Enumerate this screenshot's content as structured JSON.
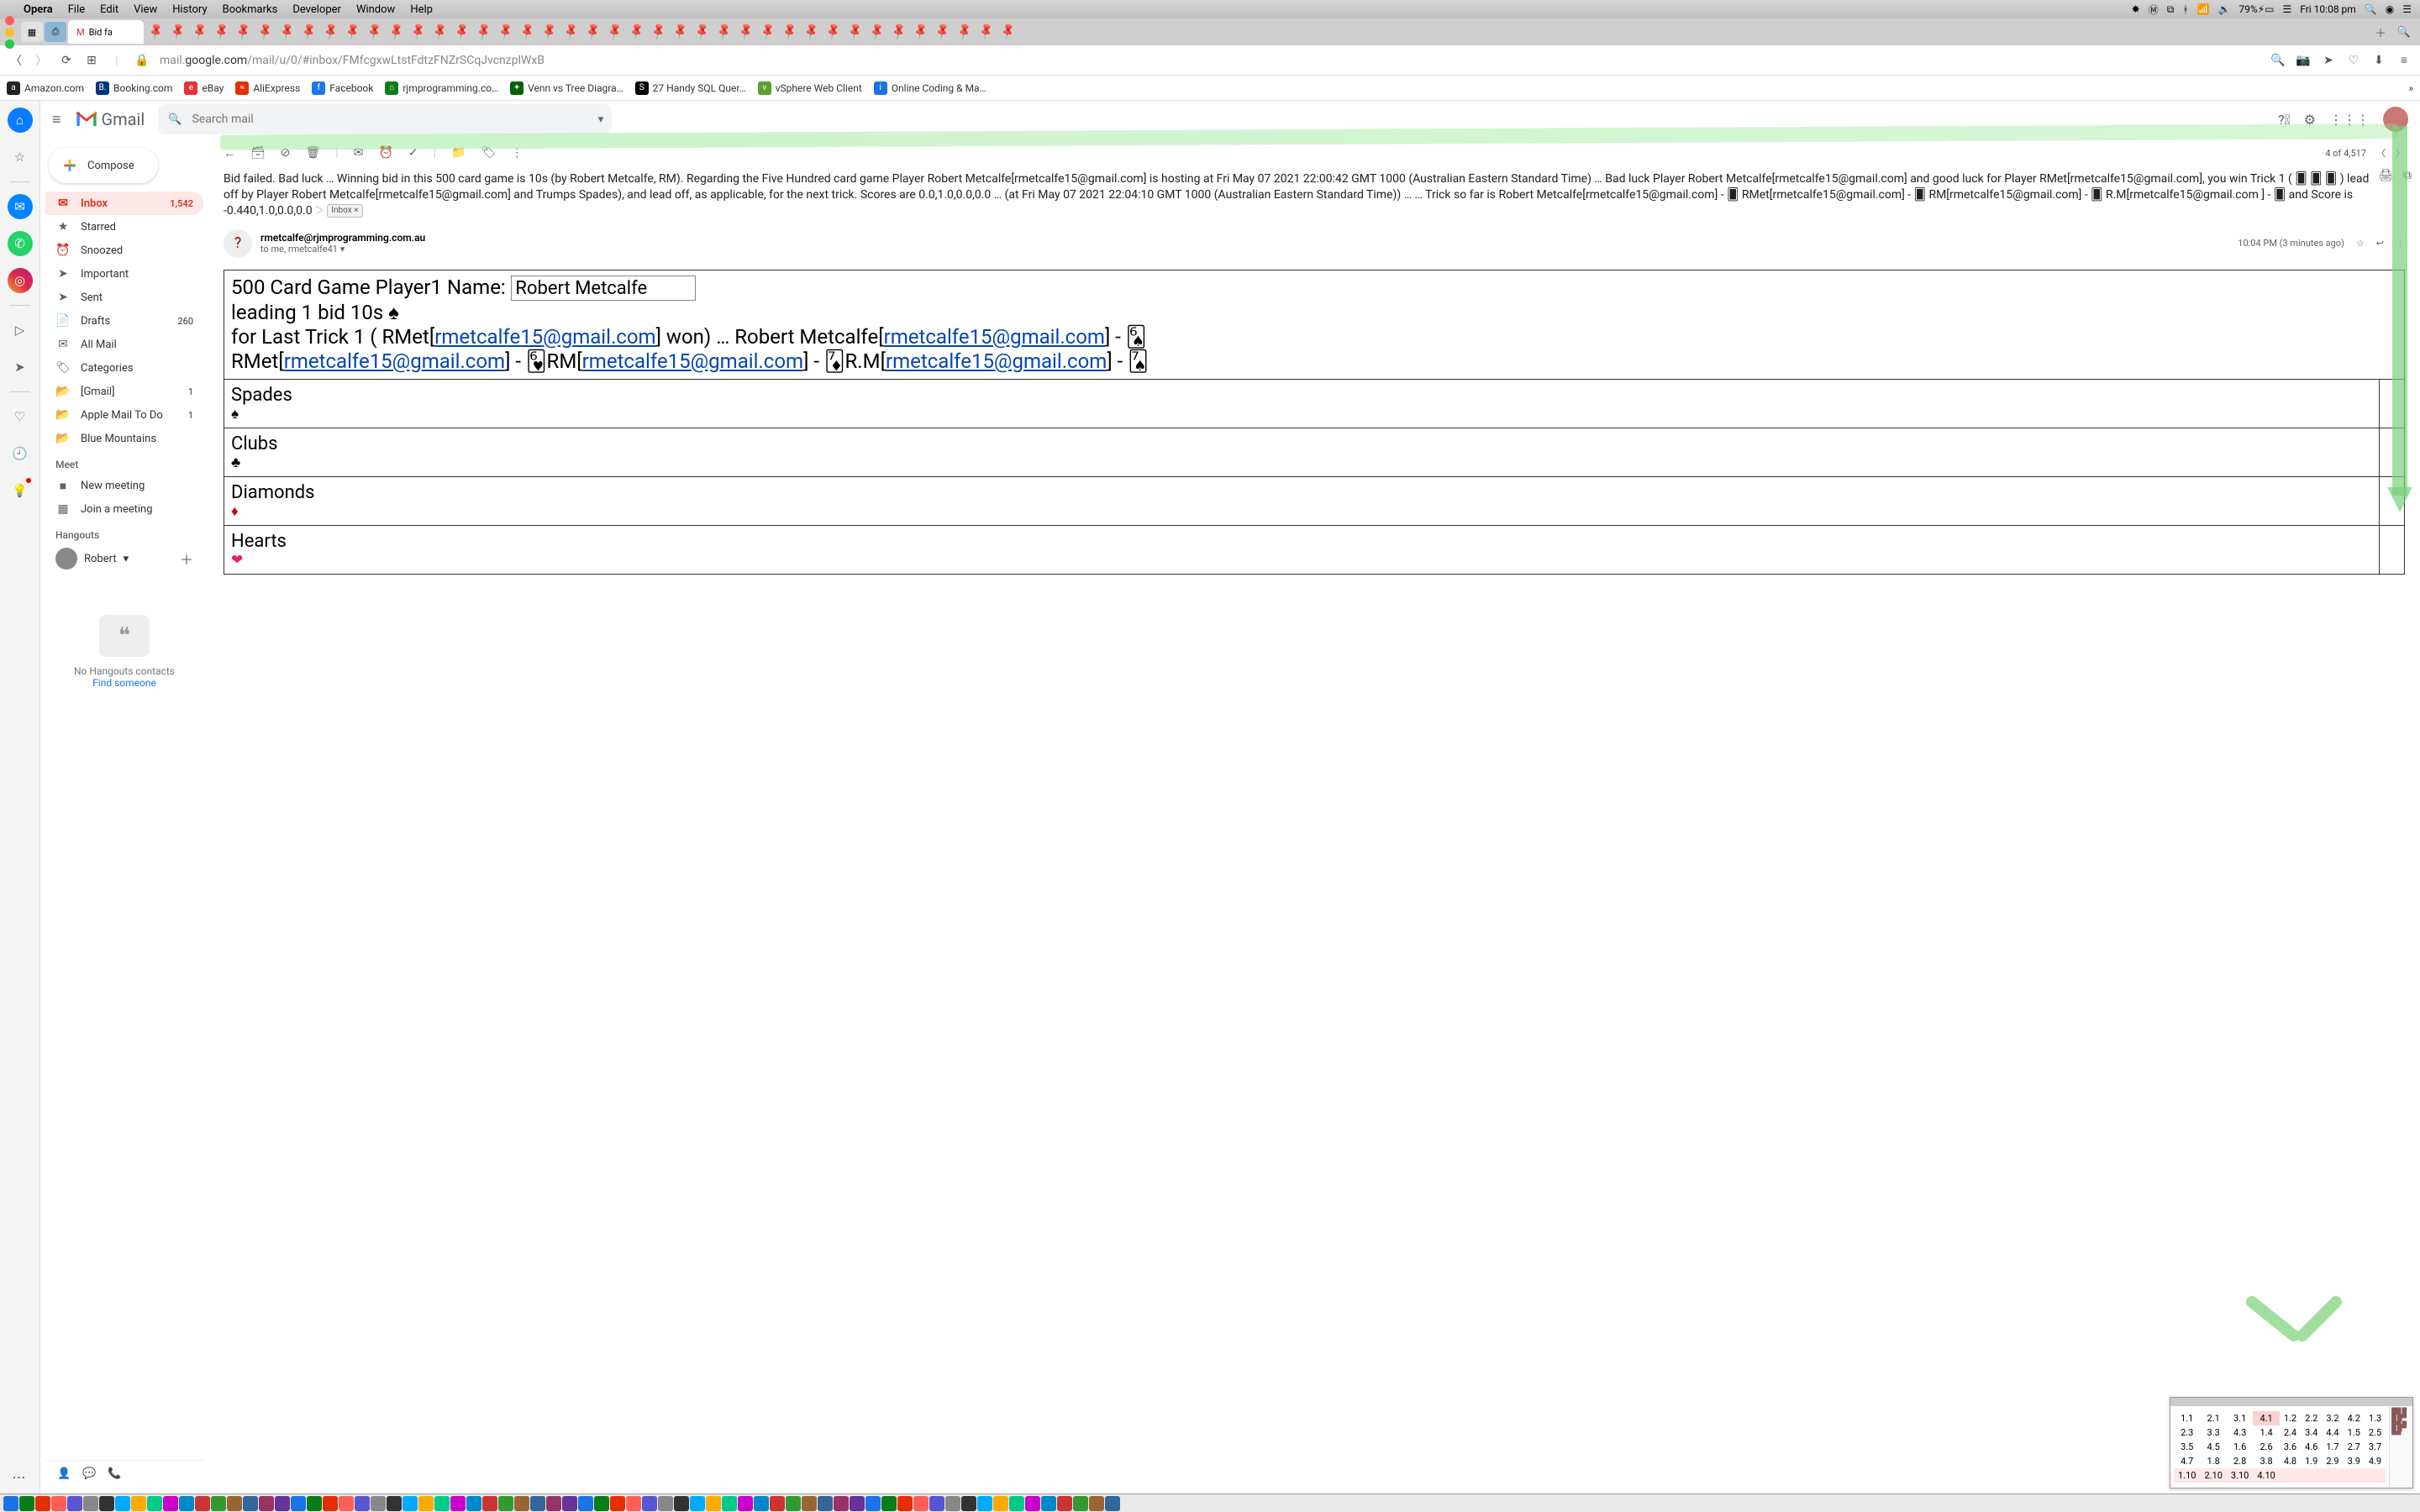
{
  "menubar": {
    "app": "Opera",
    "items": [
      "File",
      "Edit",
      "View",
      "History",
      "Bookmarks",
      "Developer",
      "Window",
      "Help"
    ],
    "battery": "79%",
    "clock": "Fri 10:08 pm"
  },
  "tabs": {
    "active_title": "Bid fa",
    "pinned_count": 40
  },
  "address": {
    "url_gray_prefix": "mail.",
    "url_host": "google.com",
    "url_path": "/mail/u/0/#inbox/FMfcgxwLtstFdtzFNZrSCqJvcnzplWxB"
  },
  "bookmarks": [
    {
      "label": "Amazon.com",
      "bg": "#222",
      "tx": "a"
    },
    {
      "label": "Booking.com",
      "bg": "#003580",
      "tx": "B."
    },
    {
      "label": "eBay",
      "bg": "#e53238",
      "tx": "e"
    },
    {
      "label": "AliExpress",
      "bg": "#e62e04",
      "tx": "≈"
    },
    {
      "label": "Facebook",
      "bg": "#1877f2",
      "tx": "f"
    },
    {
      "label": "rjmprogramming.co…",
      "bg": "#0a7d18",
      "tx": "⌂"
    },
    {
      "label": "Venn vs Tree Diagra…",
      "bg": "#006400",
      "tx": "✦"
    },
    {
      "label": "27 Handy SQL Quer…",
      "bg": "#000",
      "tx": "S"
    },
    {
      "label": "vSphere Web Client",
      "bg": "#5aa02c",
      "tx": "v"
    },
    {
      "label": "Online Coding & Ma…",
      "bg": "#1a73e8",
      "tx": "i"
    }
  ],
  "gmail": {
    "brand": "Gmail",
    "search_placeholder": "Search mail",
    "compose": "Compose",
    "side": [
      {
        "icon": "✉",
        "label": "Inbox",
        "count": "1,542",
        "key": "inbox"
      },
      {
        "icon": "★",
        "label": "Starred"
      },
      {
        "icon": "⏰",
        "label": "Snoozed"
      },
      {
        "icon": "➤",
        "label": "Important"
      },
      {
        "icon": "➤",
        "label": "Sent"
      },
      {
        "icon": "📄",
        "label": "Drafts",
        "count": "260"
      },
      {
        "icon": "✉",
        "label": "All Mail"
      },
      {
        "icon": "🏷",
        "label": "Categories"
      },
      {
        "icon": "📂",
        "label": "[Gmail]",
        "count": "1"
      },
      {
        "icon": "📂",
        "label": "Apple Mail To Do",
        "count": "1"
      },
      {
        "icon": "📂",
        "label": "Blue Mountains"
      }
    ],
    "meet_hdr": "Meet",
    "meet": [
      {
        "icon": "■",
        "label": "New meeting"
      },
      {
        "icon": "▦",
        "label": "Join a meeting"
      }
    ],
    "hangouts_hdr": "Hangouts",
    "hangout_user": "Robert",
    "no_hangouts": "No Hangouts contacts",
    "find_someone": "Find someone",
    "toolbar_count": "4 of 4,517",
    "subject": "Bid failed. Bad luck … Winning bid in this 500 card game is 10s (by Robert Metcalfe, RM). Regarding the Five Hundred card game Player Robert Metcalfe[rmetcalfe15@gmail.com] is hosting at Fri May 07 2021 22:00:42 GMT 1000 (Australian Eastern Standard Time) … Bad luck Player Robert Metcalfe[rmetcalfe15@gmail.com] and good luck for Player RMet[rmetcalfe15@gmail.com], you win Trick 1 ( 🂠 🂠 🂠 ) lead off by Player Robert Metcalfe[rmetcalfe15@gmail.com] and Trumps Spades), and lead off, as applicable, for the next trick. Scores are 0.0,1.0,0.0,0.0 … (at Fri May 07 2021 22:04:10 GMT 1000 (Australian Eastern Standard Time)) … … Trick so far is Robert Metcalfe[rmetcalfe15@gmail.com] - 🂠 RMet[rmetcalfe15@gmail.com] - 🂠 RM[rmetcalfe15@gmail.com] - 🂠 R.M[rmetcalfe15@gmail.com ] - 🂠 and Score is -0.440,1.0,0.0,0.0",
    "inbox_chip": "Inbox",
    "sender_addr": "rmetcalfe@rjmprogramming.com.au",
    "sender_to": "to me, rmetcalfe41",
    "sent_time": "10:04 PM (3 minutes ago)"
  },
  "mail": {
    "title_prefix": "500 Card Game Player1 Name:",
    "player_name": "Robert Metcalfe",
    "line2": "leading 1 bid 10s ♠",
    "line3_a": "for Last Trick 1 ( RMet[",
    "email": "rmetcalfe15@gmail.com",
    "line3_b": "] won) … Robert Metcalfe[",
    "line3_c": "] - 🂦",
    "line4_a": "RMet[",
    "line4_b": "] - 🂶RM[",
    "line4_c": "] - 🃇R.M[",
    "line4_d": "] - 🂧",
    "suits": {
      "spades": "Spades",
      "clubs": "Clubs",
      "diamonds": "Diamonds",
      "hearts": "Hearts",
      "spade_sym": "♠",
      "club_sym": "♣",
      "diamond_sym": "♦",
      "heart_sym": "❤"
    }
  },
  "chart_data": {
    "type": "table",
    "title": "numeric grid overlay",
    "rows": [
      [
        "1.1",
        "2.1",
        "3.1",
        "4.1",
        "1.2",
        "2.2",
        "3.2",
        "4.2",
        "1.3"
      ],
      [
        "2.3",
        "3.3",
        "4.3",
        "1.4",
        "2.4",
        "3.4",
        "4.4",
        "1.5",
        "2.5"
      ],
      [
        "3.5",
        "4.5",
        "1.6",
        "2.6",
        "3.6",
        "4.6",
        "1.7",
        "2.7",
        "3.7"
      ],
      [
        "4.7",
        "1.8",
        "2.8",
        "3.8",
        "4.8",
        "1.9",
        "2.9",
        "3.9",
        "4.9"
      ],
      [
        "1.10",
        "2.10",
        "3.10",
        "4.10",
        "",
        "",
        "",
        "",
        ""
      ]
    ]
  }
}
